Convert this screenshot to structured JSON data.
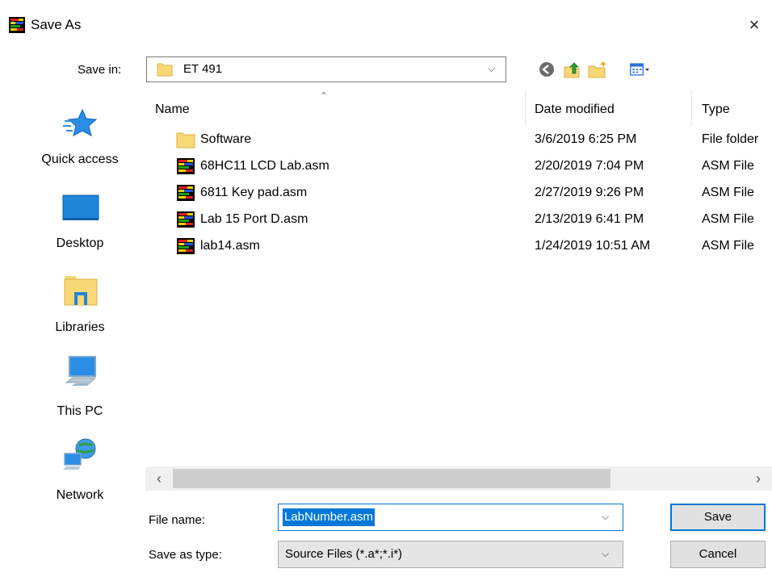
{
  "window": {
    "title": "Save As",
    "close_glyph": "×"
  },
  "save_in": {
    "label": "Save in:",
    "value": "ET 491"
  },
  "toolbar": {
    "icons": [
      "back-icon",
      "up-folder-icon",
      "new-folder-icon",
      "views-menu-icon"
    ]
  },
  "places": [
    {
      "label": "Quick access",
      "icon": "quick-access-star-icon"
    },
    {
      "label": "Desktop",
      "icon": "desktop-icon"
    },
    {
      "label": "Libraries",
      "icon": "libraries-icon"
    },
    {
      "label": "This PC",
      "icon": "this-pc-icon"
    },
    {
      "label": "Network",
      "icon": "network-icon"
    }
  ],
  "file_list": {
    "columns": {
      "name": "Name",
      "date": "Date modified",
      "type": "Type"
    },
    "rows": [
      {
        "name": "Software",
        "date": "3/6/2019 6:25 PM",
        "type": "File folder",
        "icon": "folder-icon"
      },
      {
        "name": "68HC11 LCD Lab.asm",
        "date": "2/20/2019 7:04 PM",
        "type": "ASM File",
        "icon": "asm-file-icon"
      },
      {
        "name": "6811 Key pad.asm",
        "date": "2/27/2019 9:26 PM",
        "type": "ASM File",
        "icon": "asm-file-icon"
      },
      {
        "name": "Lab 15 Port D.asm",
        "date": "2/13/2019 6:41 PM",
        "type": "ASM File",
        "icon": "asm-file-icon"
      },
      {
        "name": "lab14.asm",
        "date": "1/24/2019 10:51 AM",
        "type": "ASM File",
        "icon": "asm-file-icon"
      }
    ]
  },
  "file_name": {
    "label": "File name:",
    "value": "LabNumber.asm"
  },
  "save_as_type": {
    "label": "Save as type:",
    "value": "Source Files (*.a*;*.i*)"
  },
  "buttons": {
    "save": "Save",
    "cancel": "Cancel"
  },
  "colors": {
    "accent": "#0078d7",
    "folder": "#f8d775",
    "selection": "#0078d7"
  }
}
